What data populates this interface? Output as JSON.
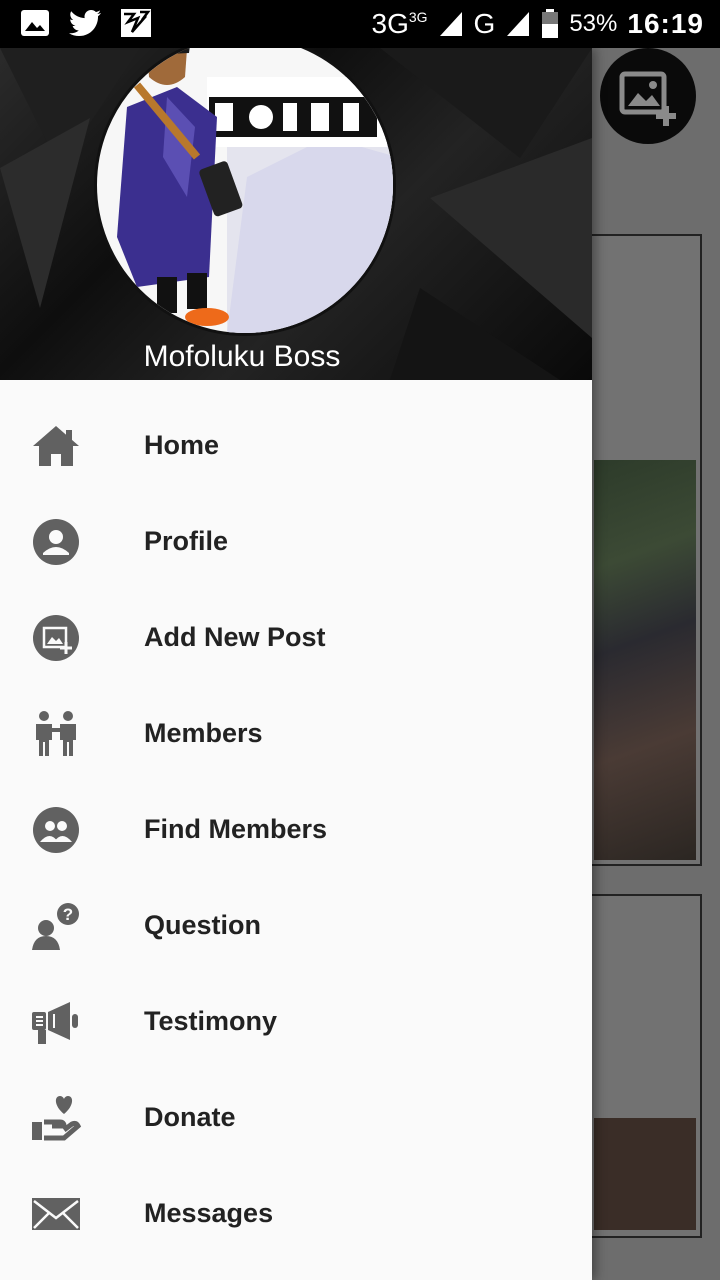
{
  "status_bar": {
    "network_left": "3G",
    "network_small": "3G",
    "network_right": "G",
    "battery": "53%",
    "time": "16:19"
  },
  "drawer": {
    "user": {
      "name": "Mofoluku Boss"
    },
    "menu": [
      {
        "label": "Home",
        "icon": "home-icon"
      },
      {
        "label": "Profile",
        "icon": "profile-icon"
      },
      {
        "label": "Add New Post",
        "icon": "add-photo-icon"
      },
      {
        "label": "Members",
        "icon": "members-icon"
      },
      {
        "label": "Find Members",
        "icon": "find-members-icon"
      },
      {
        "label": "Question",
        "icon": "question-icon"
      },
      {
        "label": "Testimony",
        "icon": "megaphone-icon"
      },
      {
        "label": "Donate",
        "icon": "donate-icon"
      },
      {
        "label": "Messages",
        "icon": "mail-icon"
      }
    ]
  },
  "colors": {
    "icon": "#616161",
    "drawer_bg": "#fafafa",
    "text": "#222222"
  }
}
